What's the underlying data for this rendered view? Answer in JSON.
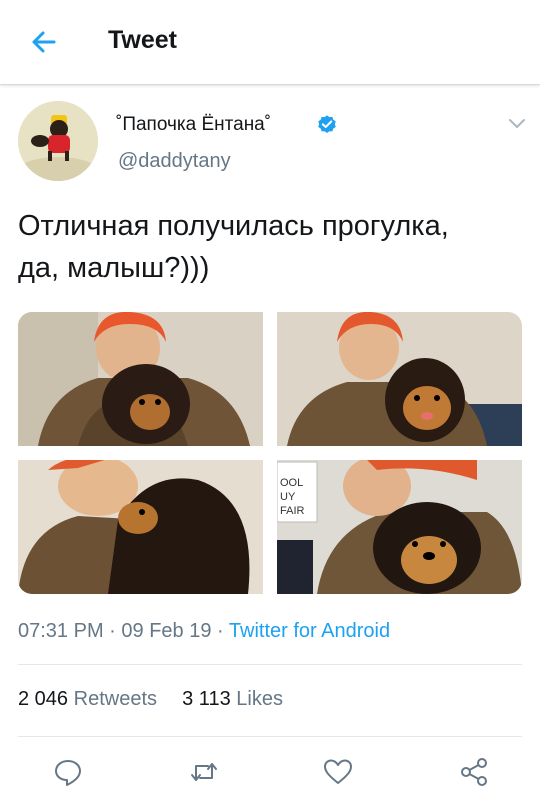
{
  "header": {
    "title": "Tweet",
    "back_icon": "arrow-left-icon"
  },
  "tweet": {
    "author_name": "˚Папочка Ёнтана˚",
    "verified": true,
    "handle": "@daddytany",
    "text_line1": "Отличная получилась прогулка,",
    "text_line2": "да, малыш?)))",
    "photos": [
      "photo-1",
      "photo-2",
      "photo-3",
      "photo-4"
    ],
    "time": "07:31 PM",
    "date": "09 Feb 19",
    "source": "Twitter for Android",
    "retweets_count": "2 046",
    "retweets_label": "Retweets",
    "likes_count": "3 113",
    "likes_label": "Likes"
  },
  "photo4_sign": [
    "OOL",
    "UY",
    "FAIR"
  ],
  "colors": {
    "accent": "#1da1f2",
    "text": "#14171a",
    "secondary": "#657786",
    "divider": "#e1e8ed"
  },
  "actions": [
    "reply-icon",
    "retweet-icon",
    "like-icon",
    "share-icon"
  ]
}
